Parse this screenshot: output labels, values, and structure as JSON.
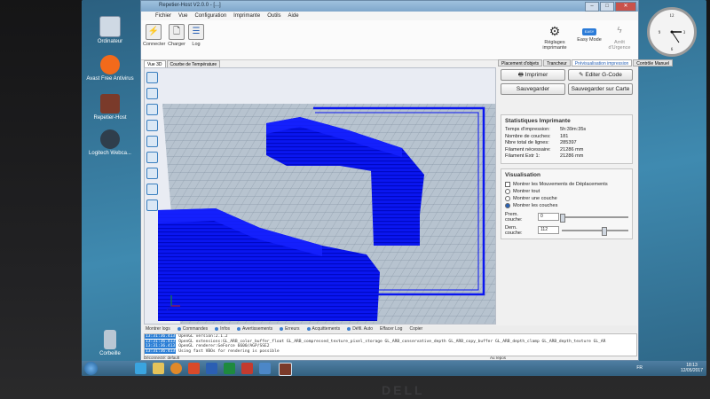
{
  "window": {
    "title": "Repetier-Host V2.0.0 - [...]",
    "menu": [
      "Fichier",
      "Vue",
      "Configuration",
      "Imprimante",
      "Outils",
      "Aide"
    ],
    "controls": {
      "min": "–",
      "max": "□",
      "close": "✕"
    }
  },
  "toolbar": {
    "connect": "Connecter",
    "load": "Charger",
    "log": "Log",
    "printer_settings": "Réglages imprimante",
    "easy_mode": "Easy Mode",
    "emergency": "Arrêt d'Urgence",
    "easy_badge": "EASY"
  },
  "view_tabs": [
    "Vue 3D",
    "Courbe de Température"
  ],
  "right_tabs": [
    "Placement d'objets",
    "Trancheur",
    "Prévisualisation impression",
    "Contrôle Manuel"
  ],
  "buttons": {
    "print": "Imprimer",
    "edit_gcode": "Editer G-Code",
    "save": "Sauvegarder",
    "save_sd": "Sauvegarder sur Carte"
  },
  "stats": {
    "title": "Statistiques Imprimante",
    "rows": [
      {
        "label": "Temps d'impression:",
        "value": "5h:39m:35s"
      },
      {
        "label": "Nombre de couches:",
        "value": "181"
      },
      {
        "label": "Nbre total de lignes:",
        "value": "285397"
      },
      {
        "label": "Filament nécessaire:",
        "value": "21286 mm"
      },
      {
        "label": "Filament Extr 1:",
        "value": "21286 mm"
      }
    ]
  },
  "visualisation": {
    "title": "Visualisation",
    "show_moves": "Montrer les Mouvements de Déplacements",
    "options": [
      "Montrer tout",
      "Montrer une couche",
      "Montrer les couches"
    ],
    "selected": 2,
    "first_layer_label": "Prem. couche:",
    "first_layer": "0",
    "last_layer_label": "Dern. couche:",
    "last_layer": "112",
    "first_layer_frac": 0.0,
    "last_layer_frac": 0.62
  },
  "log_bar": [
    "Montrer logs",
    "Commandes",
    "Infos",
    "Avertissements",
    "Erreurs",
    "Acquittements",
    "Défil. Auto",
    "Effacer Log",
    "Copier"
  ],
  "log_lines": [
    {
      "time": "13:31:36.413",
      "text": "OpenGL version:2.1.2"
    },
    {
      "time": "13:31:36.413",
      "text": "OpenGL extensions:GL_ARB_color_buffer_float GL_ARB_compressed_texture_pixel_storage GL_ARB_conservative_depth GL_ARB_copy_buffer GL_ARB_depth_clamp GL_ARB_depth_texture GL_AR"
    },
    {
      "time": "13:31:36.413",
      "text": "OpenGL renderer:GeForce 6600/AGP/SSE2"
    },
    {
      "time": "13:31:36.413",
      "text": "Using fast VBOs for rendering is possible"
    }
  ],
  "status": {
    "left": "Déconnecté: default",
    "right": "Au repos"
  },
  "desktop_icons": [
    {
      "label": "Ordinateur"
    },
    {
      "label": "Avast Free Antivirus"
    },
    {
      "label": "Repetier-Host"
    },
    {
      "label": "Logitech Webca..."
    },
    {
      "label": "Corbeille"
    }
  ],
  "tray": {
    "lang": "FR",
    "time": "18:13",
    "date": "12/05/2017"
  },
  "monitor_brand": "DELL",
  "colors": {
    "model": "#0a16f0",
    "bed": "#b7c3cf",
    "grid": "#6e7c8a",
    "accent": "#2a62b5"
  }
}
